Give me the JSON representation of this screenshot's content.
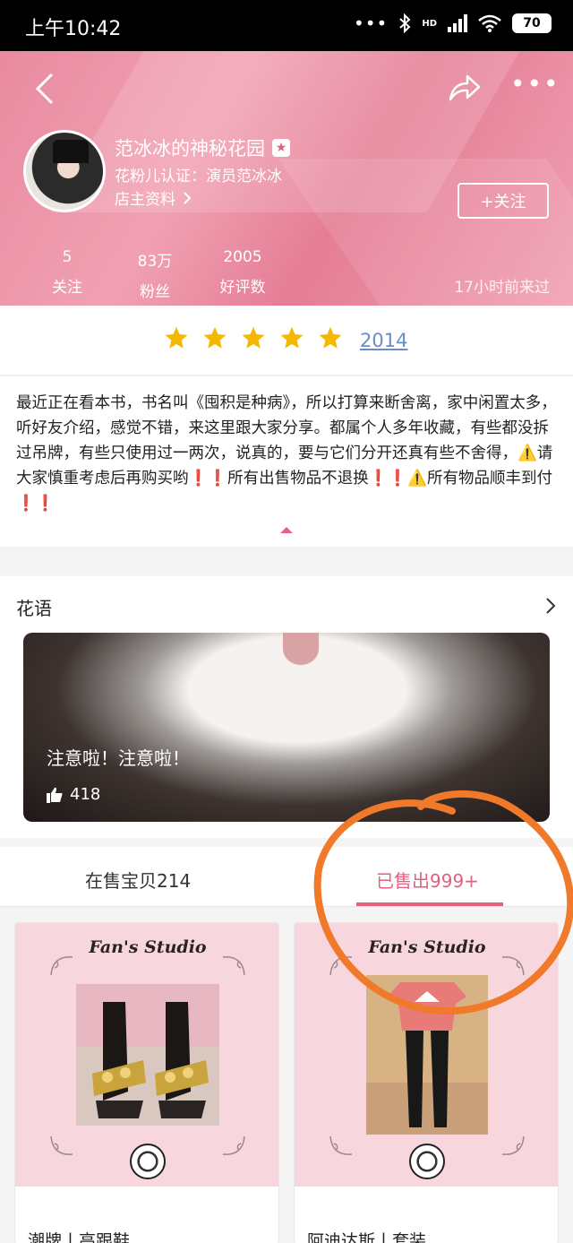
{
  "status_bar": {
    "time": "上午10:42",
    "network": "HD",
    "battery": "70"
  },
  "shop": {
    "name": "范冰冰的神秘花园",
    "certification": "花粉儿认证：演员范冰冰",
    "owner_info_label": "店主资料",
    "follow_label": "+关注",
    "last_visit": "17小时前来过",
    "stats": [
      {
        "value": "5",
        "label": "关注"
      },
      {
        "value": "83万",
        "label": "粉丝"
      },
      {
        "value": "2005",
        "label": "好评数"
      }
    ]
  },
  "rating": {
    "stars": 5,
    "count": "2014",
    "star_color": "#f5b800"
  },
  "description": {
    "text": "最近正在看本书，书名叫《囤积是种病》，所以打算来断舍离，家中闲置太多，听好友介绍，感觉不错，来这里跟大家分享。都属个人多年收藏，有些都没拆过吊牌，有些只使用过一两次，说真的，要与它们分开还真有些不舍得，⚠️请大家慎重考虑后再购买哟❗❗所有出售物品不退换❗❗⚠️所有物品顺丰到付❗❗"
  },
  "huayu": {
    "title": "花语",
    "post_caption": "注意啦！注意啦！",
    "likes": "418"
  },
  "tabs": {
    "selling": "在售宝贝214",
    "sold": "已售出999+",
    "active": "sold",
    "accent": "#e4607f"
  },
  "products": [
    {
      "studio": "Fan's Studio",
      "name": "潮牌丨高跟鞋"
    },
    {
      "studio": "Fan's Studio",
      "name": "阿迪达斯丨套装"
    }
  ],
  "annotation_color": "#f07a2a"
}
